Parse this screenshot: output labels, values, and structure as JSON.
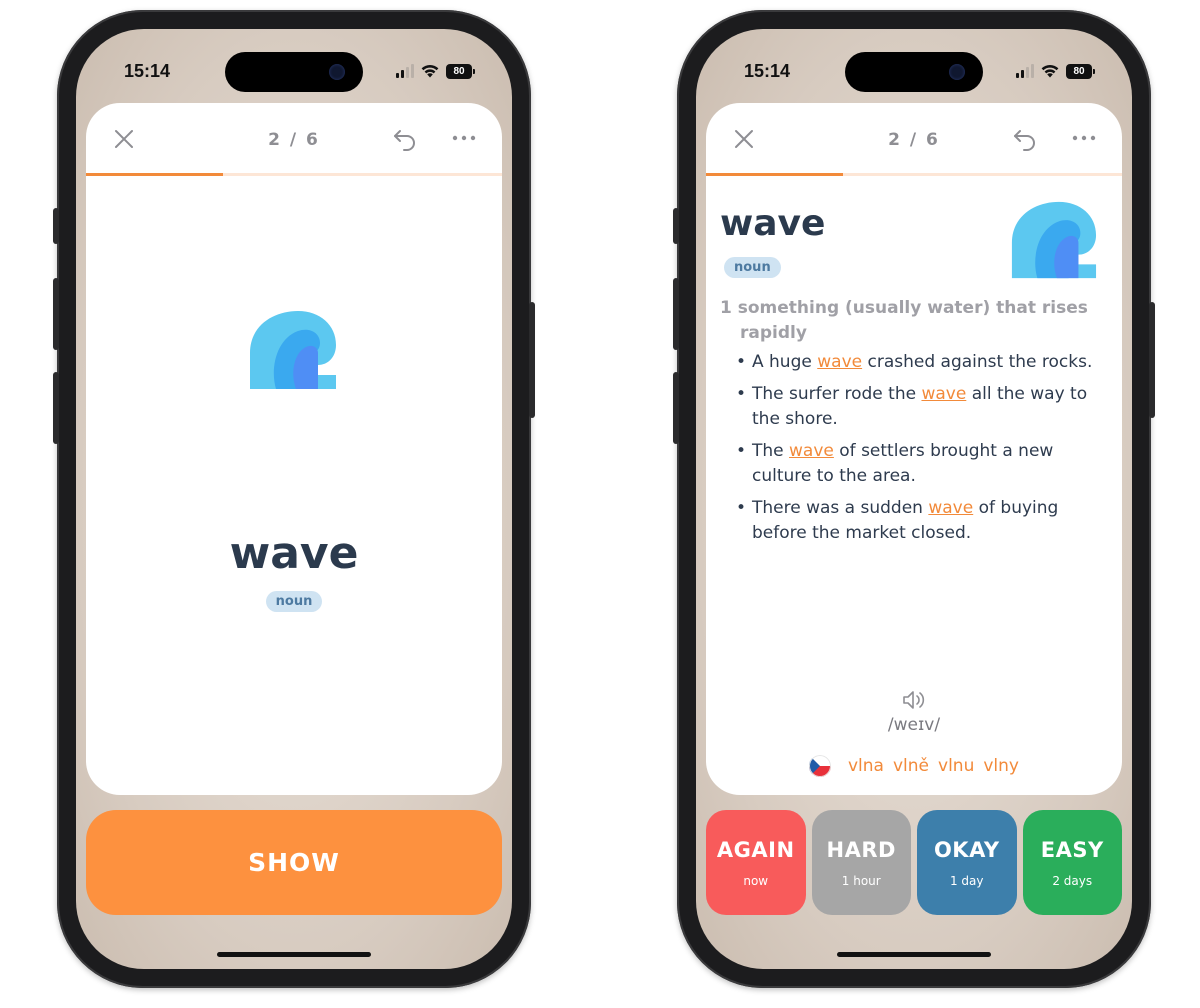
{
  "status": {
    "time": "15:14",
    "battery": "80"
  },
  "header": {
    "counter": "2 / 6",
    "progress": 0.33
  },
  "card": {
    "word": "wave",
    "pos": "noun"
  },
  "front": {
    "show_label": "SHOW"
  },
  "back": {
    "definition": "1 something (usually water) that rises rapidly",
    "examples": [
      {
        "before": "A huge ",
        "highlight": "wave",
        "after": " crashed against the rocks."
      },
      {
        "before": "The surfer rode the ",
        "highlight": "wave",
        "after": " all the way to the shore."
      },
      {
        "before": "The ",
        "highlight": "wave",
        "after": " of settlers brought a new culture to the area."
      },
      {
        "before": "There was a sudden ",
        "highlight": "wave",
        "after": " of buying before the market closed."
      }
    ],
    "phonetic": "/weɪv/",
    "translations": [
      "vlna",
      "vlně",
      "vlnu",
      "vlny"
    ],
    "grades": [
      {
        "label": "AGAIN",
        "time": "now",
        "color": "#f85b5b"
      },
      {
        "label": "HARD",
        "time": "1 hour",
        "color": "#a6a6a6"
      },
      {
        "label": "OKAY",
        "time": "1 day",
        "color": "#3d7fab"
      },
      {
        "label": "EASY",
        "time": "2 days",
        "color": "#2aae5b"
      }
    ]
  },
  "colors": {
    "accent": "#f28a3a",
    "title": "#2b3a4d"
  }
}
